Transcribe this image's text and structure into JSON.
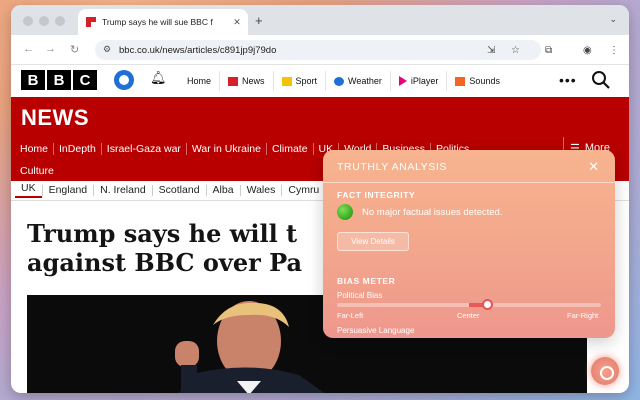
{
  "browser": {
    "tab_title": "Trump says he will sue BBC f",
    "tab_close": "✕",
    "new_tab": "+",
    "tab_menu": "⌄",
    "url": "bbc.co.uk/news/articles/c891jp9j79do"
  },
  "masthead": {
    "logo": [
      "B",
      "B",
      "C"
    ],
    "nav": [
      {
        "label": "Home",
        "icon": "home",
        "color": ""
      },
      {
        "label": "News",
        "icon": "news-icon",
        "color": "#d6202a"
      },
      {
        "label": "Sport",
        "icon": "sport-icon",
        "color": "#f5c20a"
      },
      {
        "label": "Weather",
        "icon": "weather-icon",
        "color": "#1f6fd6"
      },
      {
        "label": "iPlayer",
        "icon": "iplayer-icon",
        "color": "#e6007e"
      },
      {
        "label": "Sounds",
        "icon": "sounds-icon",
        "color": "#f26522"
      }
    ],
    "more": "•••"
  },
  "news": {
    "title": "NEWS",
    "nav_row1": [
      "Home",
      "InDepth",
      "Israel-Gaza war",
      "War in Ukraine",
      "Climate",
      "UK",
      "World",
      "Business",
      "Politics"
    ],
    "nav_row2": [
      "Culture"
    ],
    "more_label": "More",
    "sub_nav": [
      "UK",
      "England",
      "N. Ireland",
      "Scotland",
      "Alba",
      "Wales",
      "Cymru"
    ],
    "headline_line1": "Trump says he will t",
    "headline_line2": "against BBC over Pa"
  },
  "truthly": {
    "title": "TRUTHLY ANALYSIS",
    "close": "✕",
    "fact_label": "FACT INTEGRITY",
    "fact_status": "No major factual issues detected.",
    "fact_status_color": "#3fae24",
    "view_details": "View Details",
    "bias_label": "BIAS METER",
    "political_bias_label": "Political Bias",
    "bias_value": 0.57,
    "scale_left": "Far-Left",
    "scale_center": "Center",
    "scale_right": "Far-Right",
    "persuasive_label": "Persuasive Language"
  }
}
